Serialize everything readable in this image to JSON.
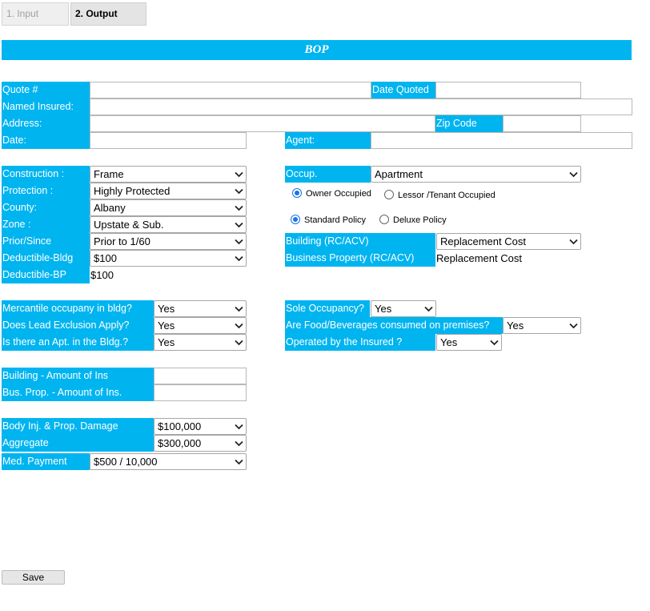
{
  "tabs": [
    {
      "label": "1. Input",
      "active": false
    },
    {
      "label": "2. Output",
      "active": true
    }
  ],
  "title": "BOP",
  "colors": {
    "accent": "#00b4f0",
    "label_text": "#ffffff",
    "radio": "#1a73e8"
  },
  "header_fields": {
    "quote_label": "Quote #",
    "quote_value": "",
    "date_quoted_label": "Date Quoted",
    "date_quoted_value": "",
    "named_insured_label": "Named Insured:",
    "named_insured_value": "",
    "address_label": "Address:",
    "address_value": "",
    "zip_label": "Zip Code",
    "zip_value": "",
    "date_label": "Date:",
    "date_value": "",
    "agent_label": "Agent:",
    "agent_value": ""
  },
  "property": {
    "construction_label": "Construction :",
    "construction_value": "Frame",
    "protection_label": "Protection :",
    "protection_value": "Highly Protected",
    "county_label": "County:",
    "county_value": "Albany",
    "zone_label": "Zone :",
    "zone_value": "Upstate & Sub.",
    "prior_since_label": "Prior/Since",
    "prior_since_value": "Prior to 1/60",
    "deductible_bldg_label": "Deductible-Bldg",
    "deductible_bldg_value": "$100",
    "deductible_bp_label": "Deductible-BP",
    "deductible_bp_value": "$100"
  },
  "occupancy": {
    "occup_label": "Occup.",
    "occup_value": "Apartment",
    "radio_owner": "Owner Occupied",
    "radio_lessor": "Lessor /Tenant Occupied",
    "owner_selected": true,
    "radio_standard": "Standard Policy",
    "radio_deluxe": "Deluxe Policy",
    "standard_selected": true,
    "building_label": "Building (RC/ACV)",
    "building_value": "Replacement Cost",
    "business_property_label": "Business Property (RC/ACV)",
    "business_property_value": "Replacement Cost"
  },
  "questions": {
    "mercantile_label": "Mercantile occupany in bldg?",
    "mercantile_value": "Yes",
    "lead_label": "Does Lead Exclusion Apply?",
    "lead_value": "Yes",
    "apt_label": "Is there an Apt. in the Bldg.?",
    "apt_value": "Yes",
    "sole_label": "Sole Occupancy?",
    "sole_value": "Yes",
    "food_label": "Are Food/Beverages consumed on premises?",
    "food_value": "Yes",
    "operated_label": "Operated by  the Insured ?",
    "operated_value": "Yes"
  },
  "amounts": {
    "building_amount_label": "Building - Amount of Ins",
    "building_amount_value": "",
    "bp_amount_label": "Bus. Prop. - Amount of Ins.",
    "bp_amount_value": ""
  },
  "liability": {
    "body_injury_label": "Body Inj. & Prop. Damage",
    "body_injury_value": "$100,000",
    "aggregate_label": "Aggregate",
    "aggregate_value": "$300,000",
    "med_payment_label": "Med. Payment",
    "med_payment_value": "$500 / 10,000"
  },
  "save_label": "Save"
}
